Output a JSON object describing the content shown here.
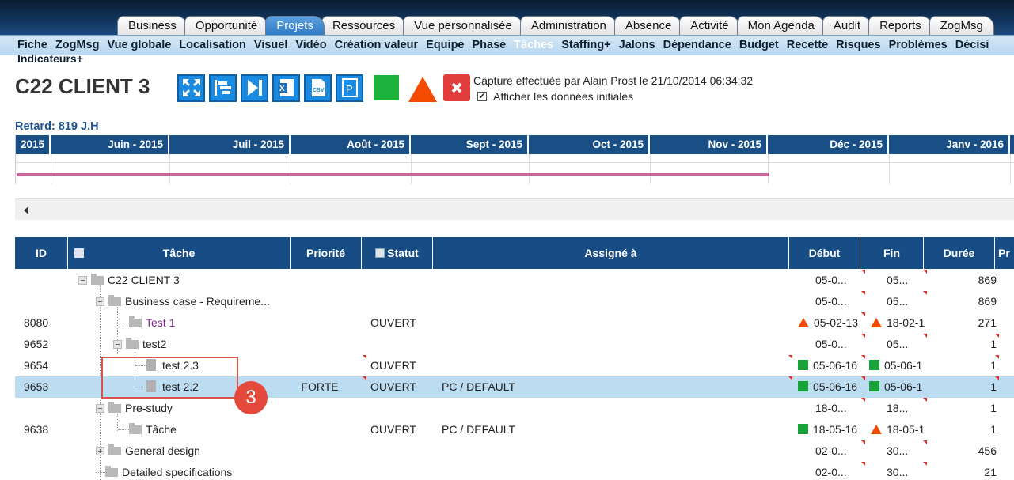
{
  "top_tabs": [
    "Business",
    "Opportunité",
    "Projets",
    "Ressources",
    "Vue personnalisée",
    "Administration",
    "Absence",
    "Activité",
    "Mon Agenda",
    "Audit",
    "Reports",
    "ZogMsg"
  ],
  "submenu": [
    "Fiche",
    "ZogMsg",
    "Vue globale",
    "Localisation",
    "Visuel",
    "Vidéo",
    "Création valeur",
    "Equipe",
    "Phase",
    "Tâches",
    "Staffing+",
    "Jalons",
    "Dépendance",
    "Budget",
    "Recette",
    "Risques",
    "Problèmes",
    "Décisi"
  ],
  "submenu_extra": "Indicateurs+",
  "project": {
    "title": "C22 CLIENT 3",
    "capture_info": "Capture effectuée par Alain Prost le 21/10/2014 06:34:32",
    "checkbox_label": "Afficher les données initiales",
    "checkbox_mark": "✔",
    "retard": "Retard: 819 J.H"
  },
  "gantt": {
    "months": [
      "2015",
      "Juin - 2015",
      "Juil - 2015",
      "Août - 2015",
      "Sept - 2015",
      "Oct - 2015",
      "Nov - 2015",
      "Déc - 2015",
      "Janv - 2016"
    ]
  },
  "table": {
    "headers": [
      "ID",
      "Tâche",
      "Priorité",
      "Statut",
      "Assigné à",
      "Début",
      "Fin",
      "Durée",
      "Pr"
    ],
    "rows": [
      {
        "id": "",
        "task": "C22 CLIENT 3",
        "pri": "",
        "stat": "",
        "assign": "",
        "deb": "05-0...",
        "fin": "05...",
        "dur": "869"
      },
      {
        "id": "",
        "task": "Business case - Requireme...",
        "pri": "",
        "stat": "",
        "assign": "",
        "deb": "05-0...",
        "fin": "05...",
        "dur": "869"
      },
      {
        "id": "8080",
        "task": "Test 1",
        "pri": "",
        "stat": "OUVERT",
        "assign": "",
        "deb": "05-02-13",
        "fin": "18-02-1",
        "dur": "271"
      },
      {
        "id": "9652",
        "task": "test2",
        "pri": "",
        "stat": "",
        "assign": "",
        "deb": "05-0...",
        "fin": "05...",
        "dur": "1"
      },
      {
        "id": "9654",
        "task": "test 2.3",
        "pri": "",
        "stat": "OUVERT",
        "assign": "",
        "deb": "05-06-16",
        "fin": "05-06-1",
        "dur": "1"
      },
      {
        "id": "9653",
        "task": "test 2.2",
        "pri": "FORTE",
        "stat": "OUVERT",
        "assign": "PC / DEFAULT",
        "deb": "05-06-16",
        "fin": "05-06-1",
        "dur": "1"
      },
      {
        "id": "",
        "task": "Pre-study",
        "pri": "",
        "stat": "",
        "assign": "",
        "deb": "18-0...",
        "fin": "18...",
        "dur": "1"
      },
      {
        "id": "9638",
        "task": "Tâche",
        "pri": "",
        "stat": "OUVERT",
        "assign": "PC / DEFAULT",
        "deb": "18-05-16",
        "fin": "18-05-1",
        "dur": "1"
      },
      {
        "id": "",
        "task": "General design",
        "pri": "",
        "stat": "",
        "assign": "",
        "deb": "02-0...",
        "fin": "30...",
        "dur": "456"
      },
      {
        "id": "",
        "task": "Detailed specifications",
        "pri": "",
        "stat": "",
        "assign": "",
        "deb": "02-0...",
        "fin": "30...",
        "dur": "21"
      }
    ]
  },
  "callout_number": "3",
  "colors": {
    "header_blue": "#174c85",
    "selected_row": "#bcdcf2",
    "alert_red": "#f24b00",
    "ok_green": "#17a33a",
    "gantt_bar": "#c8679c"
  }
}
